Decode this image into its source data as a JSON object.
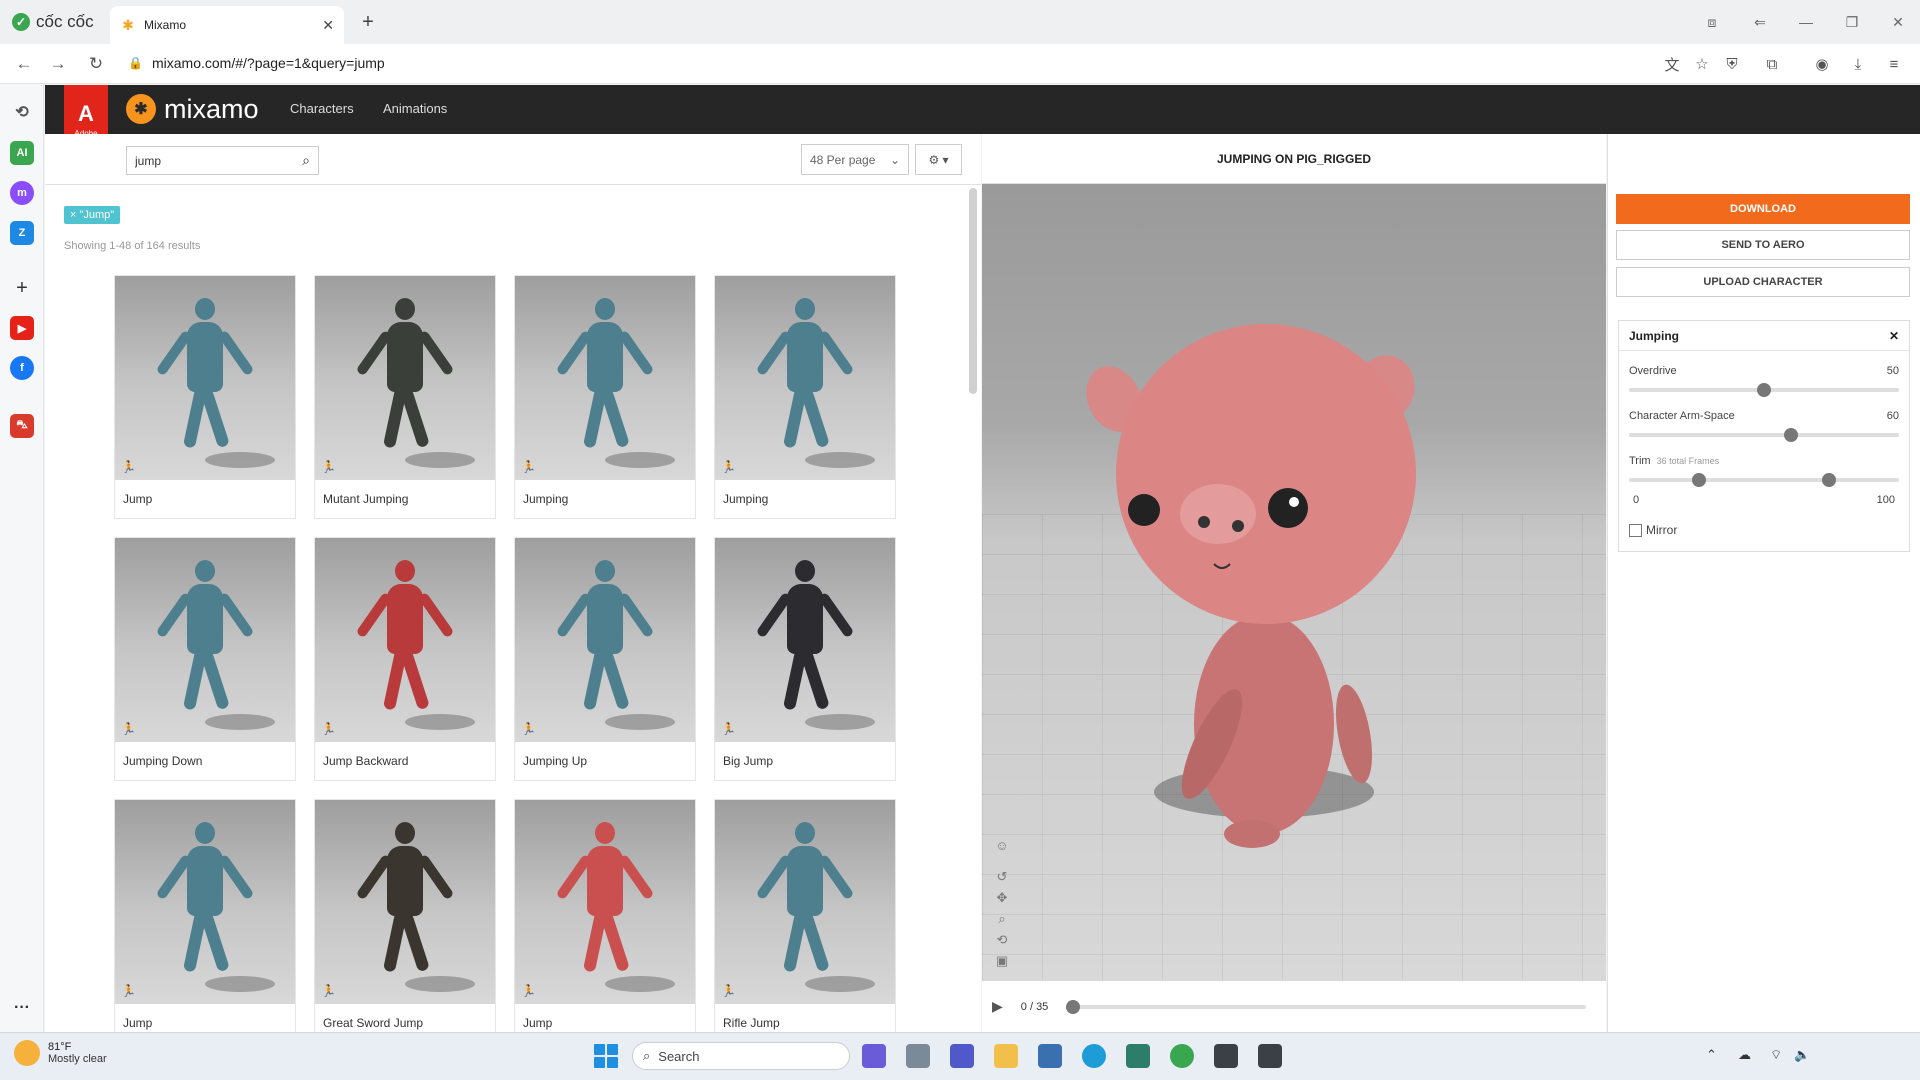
{
  "browser": {
    "brand": "cốc cốc",
    "tab_title": "Mixamo",
    "url": "mixamo.com/#/?page=1&query=jump"
  },
  "mixamo": {
    "adobe_label": "Adobe",
    "logo_text": "mixamo",
    "nav": [
      "Characters",
      "Animations"
    ],
    "search_value": "jump",
    "per_page": "48 Per page",
    "filter_tag": "× \"Jump\"",
    "showing": "Showing 1-48 of 164 results",
    "cards": [
      {
        "label": "Jump",
        "color": "#4d7f8f"
      },
      {
        "label": "Mutant Jumping",
        "color": "#3a3f3a"
      },
      {
        "label": "Jumping",
        "color": "#4d7f8f"
      },
      {
        "label": "Jumping",
        "color": "#4d7f8f"
      },
      {
        "label": "Jumping Down",
        "color": "#4d7f8f"
      },
      {
        "label": "Jump Backward",
        "color": "#b83a3a"
      },
      {
        "label": "Jumping Up",
        "color": "#4d7f8f"
      },
      {
        "label": "Big Jump",
        "color": "#2c2c30"
      },
      {
        "label": "Jump",
        "color": "#4d7f8f"
      },
      {
        "label": "Great Sword Jump",
        "color": "#3b3530"
      },
      {
        "label": "Jump",
        "color": "#c9504f"
      },
      {
        "label": "Rifle Jump",
        "color": "#4d7f8f"
      }
    ],
    "viewer_title": "JUMPING ON PIG_RIGGED",
    "frame_counter": "0 / 35",
    "buttons": {
      "download": "DOWNLOAD",
      "send": "SEND TO AERO",
      "upload": "UPLOAD CHARACTER"
    },
    "settings": {
      "title": "Jumping",
      "overdrive_label": "Overdrive",
      "overdrive_value": "50",
      "overdrive_fraction": 0.5,
      "armspace_label": "Character Arm-Space",
      "armspace_value": "60",
      "armspace_fraction": 0.6,
      "trim_label": "Trim",
      "trim_sub": "36 total Frames",
      "trim_min": "0",
      "trim_max": "100",
      "trim_start_fraction": 0.26,
      "trim_end_fraction": 0.74,
      "mirror_label": "Mirror"
    },
    "accent": "#f26b1d"
  },
  "taskbar": {
    "temp": "81°F",
    "weather": "Mostly clear",
    "search_placeholder": "Search"
  }
}
